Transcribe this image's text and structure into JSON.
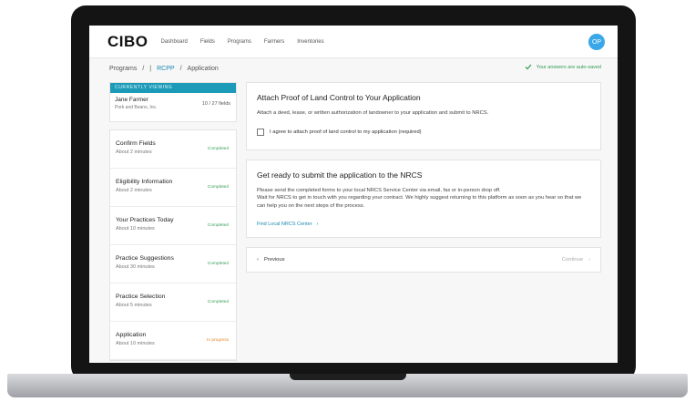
{
  "app": {
    "logo": "CIBO",
    "nav": [
      "Dashboard",
      "Fields",
      "Programs",
      "Farmers",
      "Inventories"
    ],
    "avatar": "OP"
  },
  "breadcrumb": {
    "programs": "Programs",
    "sep1": "/",
    "pipe": "|",
    "program": "RCPP",
    "sep2": "/",
    "current": "Application"
  },
  "autosave": "Your answers are auto-saved",
  "viewing": {
    "header": "CURRENTLY VIEWING",
    "name": "Jane Farmer",
    "org": "Pork and Beans, Inc.",
    "fields": "10 / 27 fields"
  },
  "steps": [
    {
      "title": "Confirm Fields",
      "duration": "About 2 minutes",
      "status": "Completed"
    },
    {
      "title": "Eligibility Information",
      "duration": "About 2 minutes",
      "status": "Completed"
    },
    {
      "title": "Your Practices Today",
      "duration": "About 10 minutes",
      "status": "Completed"
    },
    {
      "title": "Practice Suggestions",
      "duration": "About 30 minutes",
      "status": "Completed"
    },
    {
      "title": "Practice Selection",
      "duration": "About 5 minutes",
      "status": "Completed"
    },
    {
      "title": "Application",
      "duration": "About 10 minutes",
      "status": "In progress"
    }
  ],
  "proof_card": {
    "title": "Attach Proof of Land Control to Your Application",
    "text": "Attach a deed, lease, or written authorization of landowner to your application and submit to NRCS.",
    "checkbox_label": "I agree to attach proof of land control to my application (required)"
  },
  "submit_card": {
    "title": "Get ready to submit the application to the NRCS",
    "line1": "Please send the completed forms to your local NRCS Service Center via email, fax or in-person drop off.",
    "line2": "Wait for NRCS to get in touch with you regarding your contract. We highly suggest returning to this platform as soon as you hear so that we can help you on the next steps of the process.",
    "link": "Find Local NRCS Center"
  },
  "pager": {
    "previous": "Previous",
    "continue": "Continue"
  },
  "colors": {
    "accent": "#1b9bb8",
    "completed": "#3aa05a",
    "in_progress": "#e28a2b",
    "avatar": "#3aa7e8"
  }
}
